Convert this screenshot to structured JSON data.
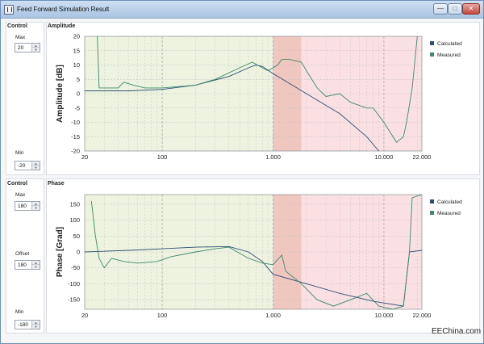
{
  "window": {
    "title": "Feed Forward Simulation Result",
    "buttons": {
      "minimize": "—",
      "maximize": "□",
      "close": "✕"
    }
  },
  "controls_top": {
    "title": "Control",
    "max_label": "Max",
    "max_value": "20",
    "min_label": "Min",
    "min_value": "-20"
  },
  "controls_bottom": {
    "title": "Control",
    "max_label": "Max",
    "max_value": "180",
    "offset_label": "Offset",
    "offset_value": "180",
    "min_label": "Min",
    "min_value": "-180"
  },
  "watermark": "EEChina.com",
  "colors": {
    "calculated": "#2d4e76",
    "measured": "#3b8a6a",
    "band_low": "#eef3df",
    "band_mid": "#f0c7bf",
    "band_high": "#fbe0e3"
  },
  "chart_data": [
    {
      "type": "line",
      "title": "Amplitude",
      "ylabel": "Amplitude [dB]",
      "xscale": "log",
      "xlim": [
        20,
        22000
      ],
      "ylim": [
        -20,
        20
      ],
      "xticks": [
        20,
        100,
        1000,
        10000,
        22000
      ],
      "xticklabels": [
        "20",
        "100",
        "1.000",
        "10.000",
        "22.000"
      ],
      "yticks": [
        20,
        15,
        10,
        5,
        0,
        -5,
        -10,
        -15,
        -20
      ],
      "grid": true,
      "legend": "top-right",
      "bands": [
        {
          "from": 20,
          "to": 1000,
          "color": "band_low"
        },
        {
          "from": 1000,
          "to": 1800,
          "color": "band_mid"
        },
        {
          "from": 1800,
          "to": 22000,
          "color": "band_high"
        }
      ],
      "series": [
        {
          "name": "Calculated",
          "color_key": "calculated",
          "points": [
            [
              20,
              1
            ],
            [
              50,
              1
            ],
            [
              100,
              1.5
            ],
            [
              200,
              3
            ],
            [
              400,
              6
            ],
            [
              600,
              9
            ],
            [
              700,
              10
            ],
            [
              800,
              9.5
            ],
            [
              1000,
              7
            ],
            [
              2000,
              0
            ],
            [
              4000,
              -7
            ],
            [
              7000,
              -15
            ],
            [
              9000,
              -20
            ]
          ]
        },
        {
          "name": "Measured",
          "color_key": "measured",
          "points": [
            [
              26,
              20
            ],
            [
              27,
              2
            ],
            [
              30,
              2
            ],
            [
              40,
              2
            ],
            [
              45,
              4
            ],
            [
              55,
              3
            ],
            [
              70,
              2
            ],
            [
              100,
              2
            ],
            [
              200,
              3
            ],
            [
              300,
              5
            ],
            [
              500,
              9
            ],
            [
              650,
              11
            ],
            [
              800,
              9
            ],
            [
              900,
              8
            ],
            [
              1100,
              10
            ],
            [
              1200,
              12
            ],
            [
              1400,
              12
            ],
            [
              1800,
              11
            ],
            [
              2000,
              8
            ],
            [
              2500,
              2
            ],
            [
              3000,
              -1
            ],
            [
              4000,
              0
            ],
            [
              5000,
              -3
            ],
            [
              7000,
              -5
            ],
            [
              8000,
              -5
            ],
            [
              10000,
              -10
            ],
            [
              13000,
              -17
            ],
            [
              15000,
              -15
            ],
            [
              16000,
              -10
            ],
            [
              18000,
              2
            ],
            [
              20000,
              20
            ]
          ]
        }
      ]
    },
    {
      "type": "line",
      "title": "Phase",
      "ylabel": "Phase [Grad]",
      "xscale": "log",
      "xlim": [
        20,
        22000
      ],
      "ylim": [
        -180,
        180
      ],
      "xticks": [
        20,
        100,
        1000,
        10000,
        22000
      ],
      "xticklabels": [
        "20",
        "100",
        "1.000",
        "10.000",
        "22.000"
      ],
      "yticks": [
        150,
        100,
        50,
        0,
        -50,
        -100,
        -150
      ],
      "grid": true,
      "legend": "top-right",
      "bands": [
        {
          "from": 20,
          "to": 1000,
          "color": "band_low"
        },
        {
          "from": 1000,
          "to": 1800,
          "color": "band_mid"
        },
        {
          "from": 1800,
          "to": 22000,
          "color": "band_high"
        }
      ],
      "series": [
        {
          "name": "Calculated",
          "color_key": "calculated",
          "points": [
            [
              20,
              0
            ],
            [
              50,
              5
            ],
            [
              100,
              10
            ],
            [
              200,
              15
            ],
            [
              400,
              17
            ],
            [
              600,
              0
            ],
            [
              800,
              -30
            ],
            [
              1000,
              -70
            ],
            [
              2000,
              -100
            ],
            [
              4000,
              -130
            ],
            [
              8000,
              -155
            ],
            [
              15000,
              -170
            ],
            [
              17000,
              0
            ],
            [
              22000,
              5
            ]
          ]
        },
        {
          "name": "Measured",
          "color_key": "measured",
          "points": [
            [
              23,
              160
            ],
            [
              25,
              50
            ],
            [
              27,
              -20
            ],
            [
              30,
              -50
            ],
            [
              35,
              -20
            ],
            [
              45,
              -30
            ],
            [
              60,
              -35
            ],
            [
              90,
              -30
            ],
            [
              120,
              -15
            ],
            [
              200,
              0
            ],
            [
              300,
              10
            ],
            [
              400,
              15
            ],
            [
              600,
              -20
            ],
            [
              800,
              -35
            ],
            [
              1000,
              -40
            ],
            [
              1200,
              -10
            ],
            [
              1300,
              -60
            ],
            [
              1800,
              -100
            ],
            [
              2500,
              -150
            ],
            [
              3500,
              -170
            ],
            [
              5000,
              -150
            ],
            [
              7000,
              -130
            ],
            [
              9000,
              -170
            ],
            [
              12000,
              -180
            ],
            [
              15000,
              -170
            ],
            [
              17000,
              0
            ],
            [
              18000,
              170
            ],
            [
              22000,
              180
            ]
          ]
        }
      ]
    }
  ]
}
